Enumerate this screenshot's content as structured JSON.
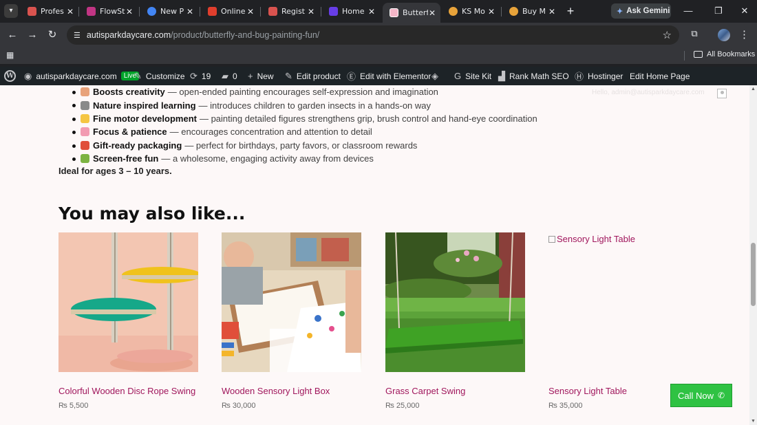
{
  "browser": {
    "tabs": [
      {
        "title": "Profes",
        "favicon_color": "#d9534f"
      },
      {
        "title": "FlowSt",
        "favicon_color": "#c13584"
      },
      {
        "title": "New P",
        "favicon_color": "#4285f4"
      },
      {
        "title": "Online",
        "favicon_color": "#e03e2d"
      },
      {
        "title": "Regist",
        "favicon_color": "#d9534f"
      },
      {
        "title": "Home",
        "favicon_color": "#673de6"
      },
      {
        "title": "Butterf",
        "favicon_color": "#f4b6c8",
        "active": true
      },
      {
        "title": "KS Mo",
        "favicon_color": "#e8a33a"
      },
      {
        "title": "Buy M",
        "favicon_color": "#e8a33a"
      }
    ],
    "ask_gemini": "Ask Gemini",
    "url_domain": "autisparkdaycare.com",
    "url_path": "/product/butterfly-and-bug-painting-fun/",
    "all_bookmarks": "All Bookmarks"
  },
  "wp_admin_bar": {
    "site_name": "autisparkdaycare.com",
    "live_badge": "Live",
    "customize": "Customize",
    "updates_count": "19",
    "comments_count": "0",
    "new": "New",
    "edit_product": "Edit product",
    "edit_elementor": "Edit with Elementor",
    "site_kit": "Site Kit",
    "rank_math": "Rank Math SEO",
    "hostinger": "Hostinger",
    "edit_home": "Edit Home Page"
  },
  "visitor_text": "Hello, admin@autisparkdaycare.com",
  "benefits": [
    {
      "title": "Boosts creativity",
      "text": "— open-ended painting encourages self-expression and imagination",
      "emoji_color": "#e8a27a"
    },
    {
      "title": "Nature inspired learning",
      "text": "— introduces children to garden insects in a hands-on way",
      "emoji_color": "#8a8a8a"
    },
    {
      "title": "Fine motor development",
      "text": "— painting detailed figures strengthens grip, brush control and hand-eye coordination",
      "emoji_color": "#f5c542"
    },
    {
      "title": "Focus & patience",
      "text": "— encourages concentration and attention to detail",
      "emoji_color": "#f29bb2"
    },
    {
      "title": "Gift-ready packaging",
      "text": "— perfect for birthdays, party favors, or classroom rewards",
      "emoji_color": "#e04f3a"
    },
    {
      "title": "Screen-free fun",
      "text": "— a wholesome, engaging activity away from devices",
      "emoji_color": "#7cb342"
    }
  ],
  "ideal_ages": "Ideal for ages 3 – 10 years.",
  "related_title": "You may also like...",
  "products": [
    {
      "name": "Colorful Wooden Disc Rope Swing",
      "price": "₨ 5,500"
    },
    {
      "name": "Wooden Sensory Light Box",
      "price": "₨ 30,000"
    },
    {
      "name": "Grass Carpet Swing",
      "price": "₨ 25,000"
    },
    {
      "name": "Sensory Light Table",
      "price": "₨ 35,000",
      "image_alt": "Sensory Light Table"
    }
  ],
  "call_now": "Call Now",
  "colors": {
    "accent_link": "#a0165c",
    "call_green": "#2fc243",
    "wp_bar": "#1d2327"
  }
}
